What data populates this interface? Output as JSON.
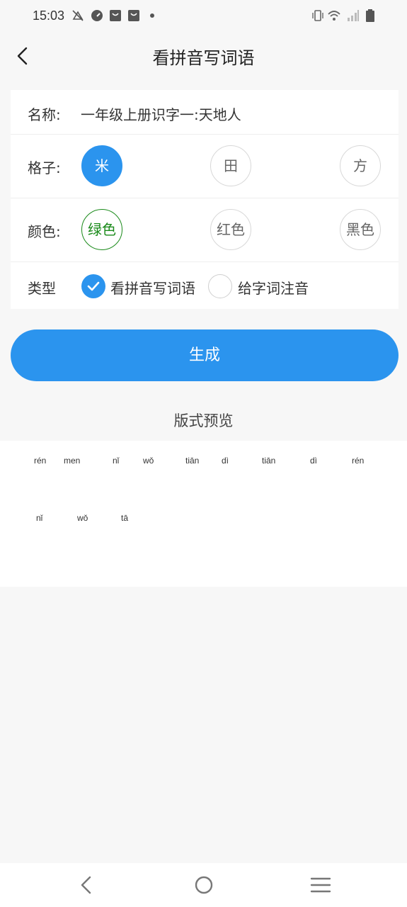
{
  "status_bar": {
    "time": "15:03",
    "icons": [
      "mute-icon",
      "speedometer-icon",
      "bag-icon",
      "bag-icon",
      "dot-icon",
      "vibrate-icon",
      "wifi-icon",
      "signal-icon",
      "battery-icon"
    ]
  },
  "header": {
    "title": "看拼音写词语"
  },
  "settings": {
    "name_label": "名称:",
    "name_value": "一年级上册识字一:天地人",
    "grid_label": "格子:",
    "grid_options": [
      "米",
      "田",
      "方"
    ],
    "grid_selected": "米",
    "color_label": "颜色:",
    "color_options": [
      "绿色",
      "红色",
      "黑色"
    ],
    "color_selected": "绿色",
    "type_label": "类型",
    "type_options": [
      "看拼音写词语",
      "给字词注音"
    ],
    "type_selected": "看拼音写词语"
  },
  "generate_label": "生成",
  "preview_title": "版式预览",
  "preview": {
    "row1": [
      "rén",
      "men",
      "nǐ",
      "wǒ",
      "tiān",
      "dì",
      "tiān",
      "dì",
      "rén"
    ],
    "row2": [
      "nǐ",
      "wǒ",
      "tā"
    ]
  },
  "colors": {
    "accent": "#2b94ee",
    "green": "#1a8a1a",
    "background": "#f7f7f7"
  }
}
